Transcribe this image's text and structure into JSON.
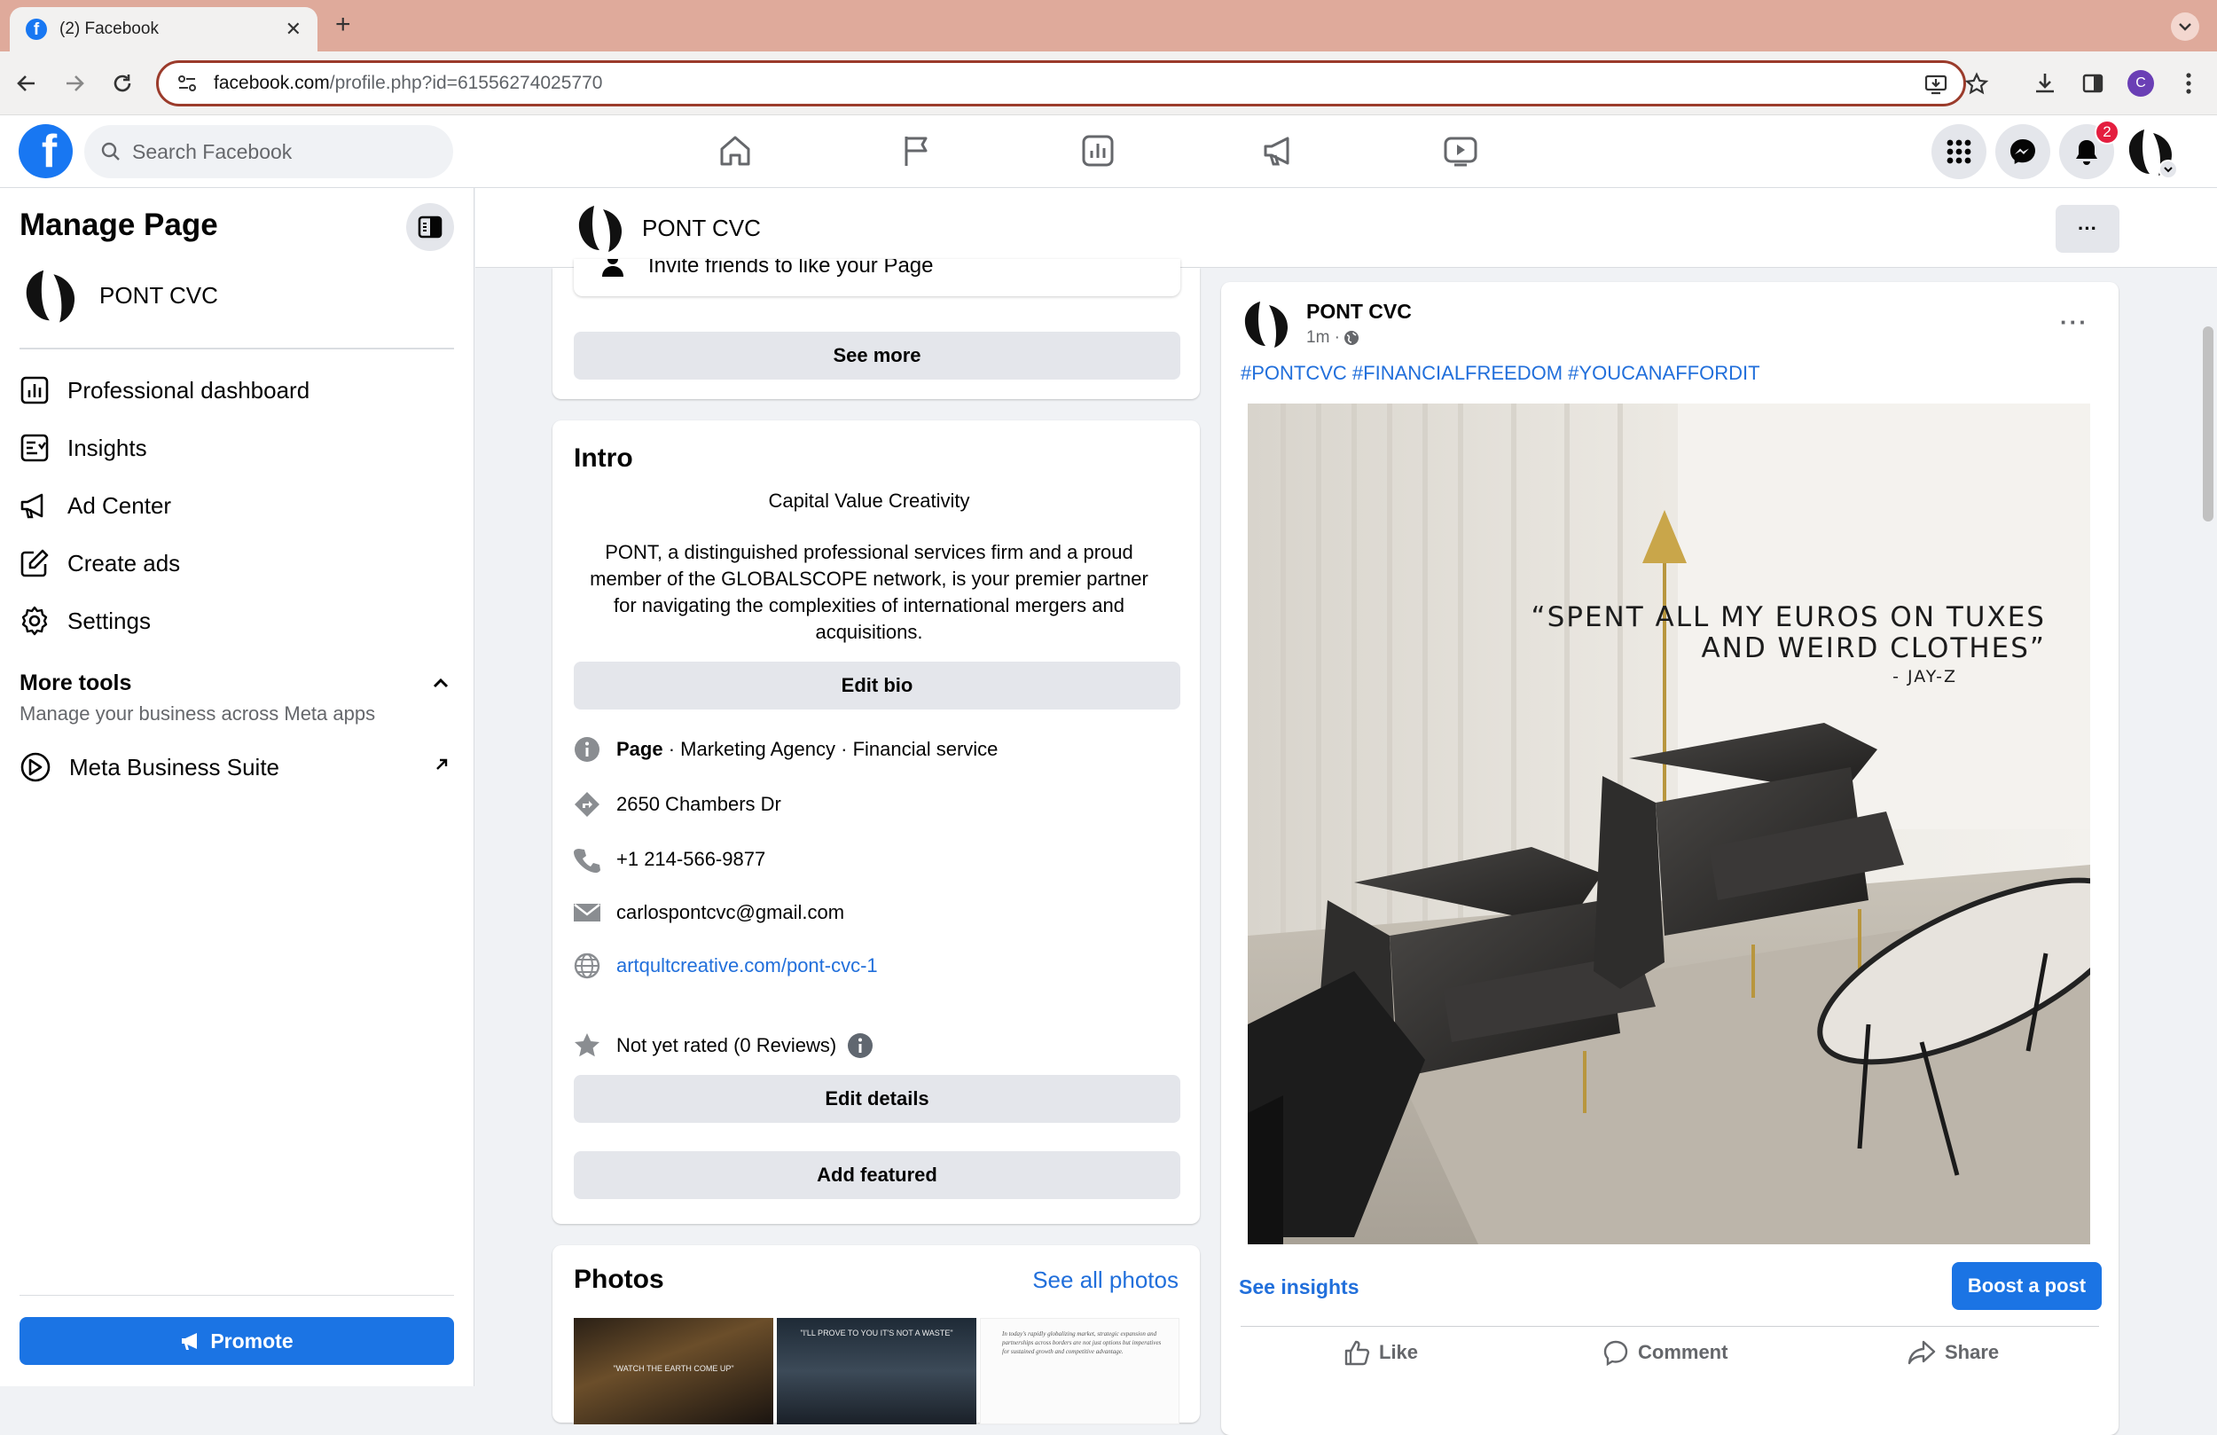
{
  "browser": {
    "tab_title": "(2) Facebook",
    "tab_close": "✕",
    "new_tab": "+",
    "url_domain": "facebook.com",
    "url_path": "/profile.php?id=61556274025770",
    "profile_initial": "C"
  },
  "fb": {
    "logo_letter": "f",
    "search_placeholder": "Search Facebook",
    "notification_count": "2"
  },
  "sidebar": {
    "title": "Manage Page",
    "page_name": "PONT CVC",
    "items": [
      {
        "label": "Professional dashboard",
        "icon": "dashboard-icon"
      },
      {
        "label": "Insights",
        "icon": "insights-icon"
      },
      {
        "label": "Ad Center",
        "icon": "megaphone-icon"
      },
      {
        "label": "Create ads",
        "icon": "edit-icon"
      },
      {
        "label": "Settings",
        "icon": "gear-icon"
      }
    ],
    "more_tools_title": "More tools",
    "more_tools_sub": "Manage your business across Meta apps",
    "meta_business_suite": "Meta Business Suite",
    "promote_label": "Promote"
  },
  "pagebar": {
    "page_name": "PONT CVC",
    "more": "···"
  },
  "top_card": {
    "invite_text": "Invite friends to like your Page",
    "see_more": "See more"
  },
  "intro": {
    "heading": "Intro",
    "category": "Capital Value Creativity",
    "bio": "PONT, a distinguished professional services firm and a proud member of the GLOBALSCOPE network, is your premier partner for navigating the complexities of international mergers and acquisitions.",
    "edit_bio": "Edit bio",
    "page_label": "Page",
    "page_types": " · Marketing Agency · Financial service",
    "address": "2650 Chambers Dr",
    "phone": "+1 214-566-9877",
    "email": "carlospontcvc@gmail.com",
    "website": "artqultcreative.com/pont-cvc-1",
    "rating": "Not yet rated (0 Reviews)",
    "edit_details": "Edit details",
    "add_featured": "Add featured"
  },
  "photos": {
    "heading": "Photos",
    "see_all": "See all photos",
    "thumb1_caption": "\"WATCH THE EARTH COME UP\"",
    "thumb2_caption": "\"I'LL PROVE TO YOU IT'S NOT A WASTE\"",
    "thumb3_caption": "In today's rapidly globalizing market, strategic expansion and partnerships across borders are not just options but imperatives for sustained growth and competitive advantage."
  },
  "post": {
    "author": "PONT CVC",
    "time": "1m · ",
    "more": "···",
    "hashtags": "#PONTCVC #FINANCIALFREEDOM #YOUCANAFFORDIT",
    "quote_line1": "“SPENT ALL MY EUROS ON TUXES",
    "quote_line2": "AND WEIRD CLOTHES”",
    "quote_author": "- JAY-Z",
    "see_insights": "See insights",
    "boost": "Boost a post",
    "like": "Like",
    "comment": "Comment",
    "share": "Share"
  },
  "colors": {
    "fb_blue": "#1877f2",
    "link_blue": "#216fdb",
    "button_blue": "#1b74e4",
    "tabbar": "#dfaa9b",
    "badge_red": "#e41e3f"
  }
}
